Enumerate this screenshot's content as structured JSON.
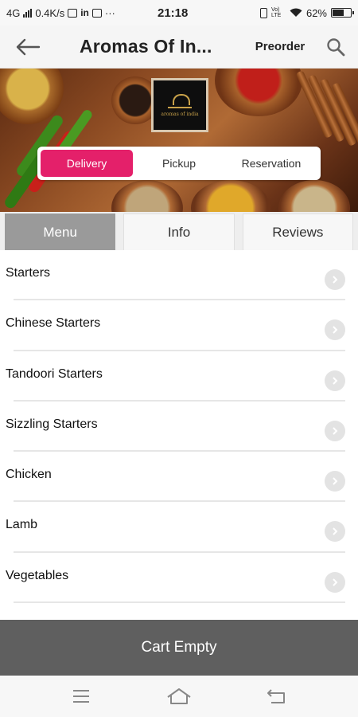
{
  "status_bar": {
    "network": "4G",
    "speed": "0.4K/s",
    "time": "21:18",
    "volte": "Vo) LTE",
    "battery": "62%",
    "notification_icons": [
      "network-signal-icon",
      "youtube-icon",
      "linkedin-icon",
      "mail-icon",
      "more-icon"
    ],
    "system_icons": [
      "vibrate-icon",
      "volte-icon",
      "wifi-icon",
      "battery-icon"
    ]
  },
  "app_bar": {
    "title": "Aromas Of In...",
    "preorder_label": "Preorder",
    "back_icon": "back-arrow-icon",
    "search_icon": "search-icon"
  },
  "hero": {
    "logo_text": "aromas of india",
    "order_types": [
      "Delivery",
      "Pickup",
      "Reservation"
    ],
    "selected_order_type": "Delivery"
  },
  "tabs": {
    "items": [
      "Menu",
      "Info",
      "Reviews"
    ],
    "active": "Menu"
  },
  "menu": {
    "items": [
      "Starters",
      "Chinese Starters",
      "Tandoori Starters",
      "Sizzling Starters",
      "Chicken",
      "Lamb",
      "Vegetables"
    ]
  },
  "cart": {
    "label": "Cart Empty"
  },
  "colors": {
    "accent": "#e4206a",
    "active_tab": "#9a9a9a",
    "cart_bar": "#5f5f5f"
  }
}
